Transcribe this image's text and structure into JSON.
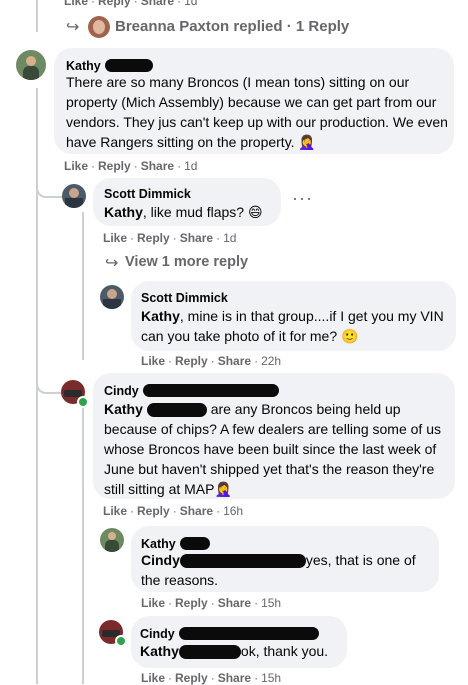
{
  "top_actions": {
    "like": "Like",
    "reply": "Reply",
    "share": "Share",
    "time": "1d"
  },
  "replied_row": {
    "name": "Breanna Paxton",
    "suffix": "replied · 1 Reply"
  },
  "comments": [
    {
      "name": "Kathy",
      "text": "There are so many Broncos (I mean tons) sitting on our property (Mich Assembly) because we can get part from our vendors. They jus can't keep up with our production. We even have Rangers sitting on the property. 🤦‍♀️",
      "actions": {
        "like": "Like",
        "reply": "Reply",
        "share": "Share",
        "time": "1d"
      }
    },
    {
      "name": "Scott Dimmick",
      "mention": "Kathy",
      "text": ", like mud flaps? 😄",
      "actions": {
        "like": "Like",
        "reply": "Reply",
        "share": "Share",
        "time": "1d"
      }
    },
    {
      "name": "Scott Dimmick",
      "mention": "Kathy",
      "text": ", mine is in that group....if I get you my VIN can you take photo of it for me? 🙂",
      "actions": {
        "like": "Like",
        "reply": "Reply",
        "share": "Share",
        "time": "22h"
      }
    },
    {
      "name": "Cindy",
      "mention": "Kathy",
      "text": "are any Broncos being held up because of chips? A few dealers are telling some of us whose Broncos have been built since the last week of June but haven't shipped yet that's the reason they're still sitting at MAP🤦‍♀️",
      "actions": {
        "like": "Like",
        "reply": "Reply",
        "share": "Share",
        "time": "16h"
      }
    },
    {
      "name": "Kathy",
      "mention": "Cindy",
      "text": "yes, that is one of the reasons.",
      "actions": {
        "like": "Like",
        "reply": "Reply",
        "share": "Share",
        "time": "15h"
      }
    },
    {
      "name": "Cindy",
      "mention": "Kathy",
      "text": "ok, thank you.",
      "actions": {
        "like": "Like",
        "reply": "Reply",
        "share": "Share",
        "time": "15h"
      }
    }
  ],
  "view_more": "View 1 more reply",
  "colors": {
    "bubble": "#f0f2f5",
    "meta": "#65676b",
    "thread": "#ccd0d5",
    "online": "#31a24c"
  }
}
